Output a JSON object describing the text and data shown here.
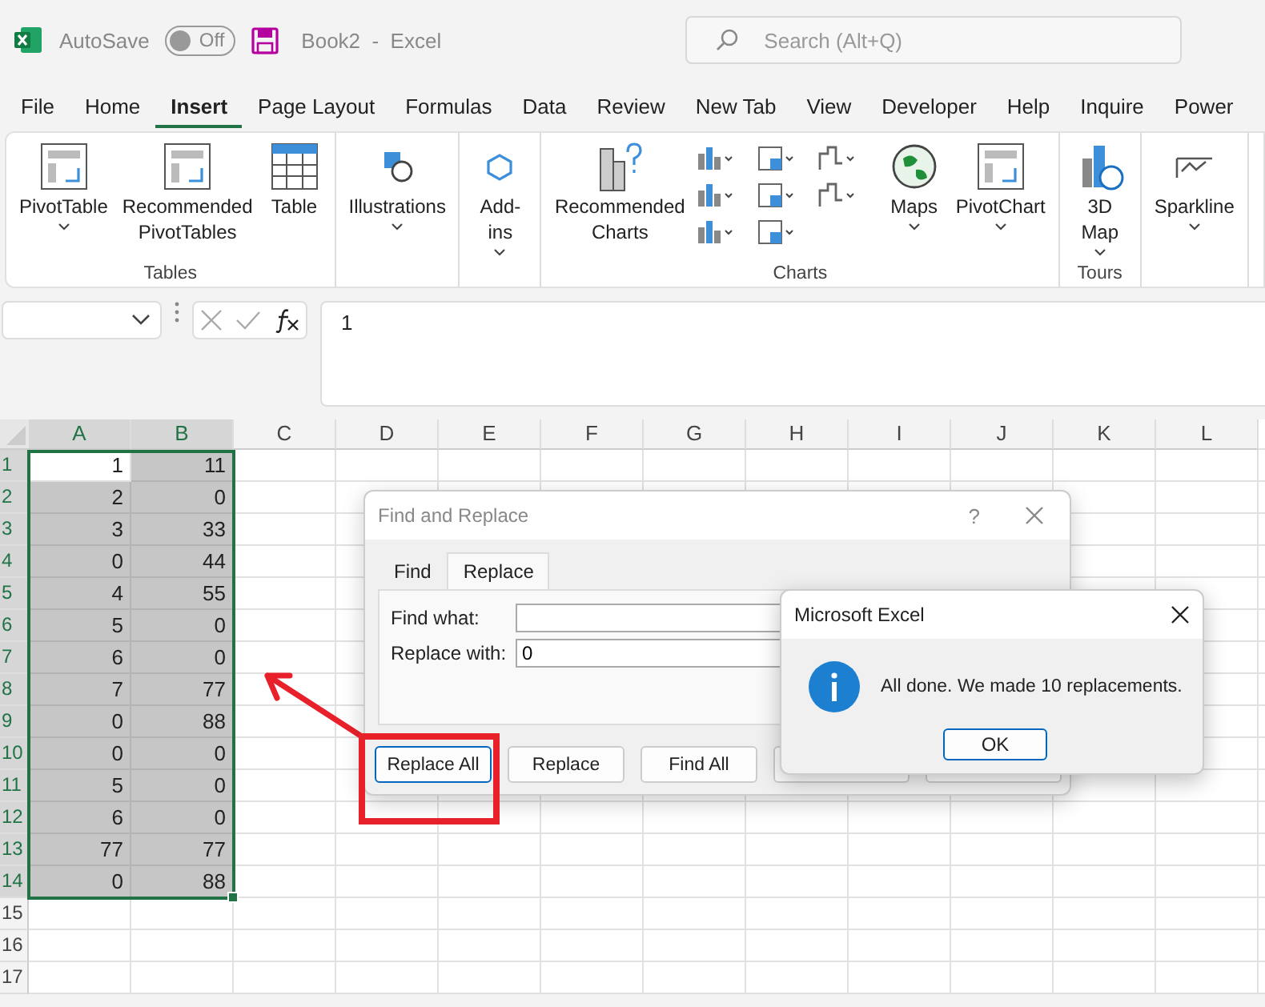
{
  "titlebar": {
    "autosave_label": "AutoSave",
    "autosave_toggle": {
      "label": "Off",
      "on": false
    },
    "document_title": "Book2  -  Excel",
    "search": {
      "placeholder": "Search (Alt+Q)"
    }
  },
  "menu_tabs": [
    {
      "label": "File",
      "selected": false
    },
    {
      "label": "Home",
      "selected": false
    },
    {
      "label": "Insert",
      "selected": true
    },
    {
      "label": "Page Layout",
      "selected": false
    },
    {
      "label": "Formulas",
      "selected": false
    },
    {
      "label": "Data",
      "selected": false
    },
    {
      "label": "Review",
      "selected": false
    },
    {
      "label": "New Tab",
      "selected": false
    },
    {
      "label": "View",
      "selected": false
    },
    {
      "label": "Developer",
      "selected": false
    },
    {
      "label": "Help",
      "selected": false
    },
    {
      "label": "Inquire",
      "selected": false
    },
    {
      "label": "Power",
      "selected": false
    }
  ],
  "ribbon": {
    "groups": [
      {
        "label": "Tables",
        "commands": [
          {
            "label": "PivotTable",
            "dropdown": true
          },
          {
            "label": "Recommended\nPivotTables",
            "dropdown": false
          },
          {
            "label": "Table",
            "dropdown": false
          }
        ]
      },
      {
        "commands": [
          {
            "label": "Illustrations",
            "dropdown": true
          }
        ]
      },
      {
        "commands": [
          {
            "label": "Add-\nins",
            "dropdown": true
          }
        ]
      },
      {
        "label": "Charts",
        "commands": [
          {
            "label": "Recommended\nCharts",
            "dropdown": false
          },
          {
            "kind": "gallery"
          },
          {
            "label": "Maps",
            "dropdown": true
          },
          {
            "label": "PivotChart",
            "dropdown": true
          }
        ]
      },
      {
        "label": "Tours",
        "commands": [
          {
            "label": "3D\nMap",
            "dropdown": true
          }
        ]
      },
      {
        "commands": [
          {
            "label": "Sparkline",
            "dropdown": true
          }
        ]
      }
    ]
  },
  "formula_bar": {
    "formula": "1"
  },
  "sheet": {
    "columns": [
      {
        "label": "A",
        "selected": true
      },
      {
        "label": "B",
        "selected": true
      },
      {
        "label": "C",
        "selected": false
      },
      {
        "label": "D",
        "selected": false
      },
      {
        "label": "E",
        "selected": false
      },
      {
        "label": "F",
        "selected": false
      },
      {
        "label": "G",
        "selected": false
      },
      {
        "label": "H",
        "selected": false
      },
      {
        "label": "I",
        "selected": false
      },
      {
        "label": "J",
        "selected": false
      },
      {
        "label": "K",
        "selected": false
      },
      {
        "label": "L",
        "selected": false
      }
    ],
    "rows": [
      {
        "header": "1",
        "selected": true,
        "cells": [
          {
            "value": "1",
            "shaded": false
          },
          {
            "value": "11",
            "shaded": true
          }
        ]
      },
      {
        "header": "2",
        "selected": true,
        "cells": [
          {
            "value": "2",
            "shaded": true
          },
          {
            "value": "0",
            "shaded": true
          }
        ]
      },
      {
        "header": "3",
        "selected": true,
        "cells": [
          {
            "value": "3",
            "shaded": true
          },
          {
            "value": "33",
            "shaded": true
          }
        ]
      },
      {
        "header": "4",
        "selected": true,
        "cells": [
          {
            "value": "0",
            "shaded": true
          },
          {
            "value": "44",
            "shaded": true
          }
        ]
      },
      {
        "header": "5",
        "selected": true,
        "cells": [
          {
            "value": "4",
            "shaded": true
          },
          {
            "value": "55",
            "shaded": true
          }
        ]
      },
      {
        "header": "6",
        "selected": true,
        "cells": [
          {
            "value": "5",
            "shaded": true
          },
          {
            "value": "0",
            "shaded": true
          }
        ]
      },
      {
        "header": "7",
        "selected": true,
        "cells": [
          {
            "value": "6",
            "shaded": true
          },
          {
            "value": "0",
            "shaded": true
          }
        ]
      },
      {
        "header": "8",
        "selected": true,
        "cells": [
          {
            "value": "7",
            "shaded": true
          },
          {
            "value": "77",
            "shaded": true
          }
        ]
      },
      {
        "header": "9",
        "selected": true,
        "cells": [
          {
            "value": "0",
            "shaded": true
          },
          {
            "value": "88",
            "shaded": true
          }
        ]
      },
      {
        "header": "10",
        "selected": true,
        "cells": [
          {
            "value": "0",
            "shaded": true
          },
          {
            "value": "0",
            "shaded": true
          }
        ]
      },
      {
        "header": "11",
        "selected": true,
        "cells": [
          {
            "value": "5",
            "shaded": true
          },
          {
            "value": "0",
            "shaded": true
          }
        ]
      },
      {
        "header": "12",
        "selected": true,
        "cells": [
          {
            "value": "6",
            "shaded": true
          },
          {
            "value": "0",
            "shaded": true
          }
        ]
      },
      {
        "header": "13",
        "selected": true,
        "cells": [
          {
            "value": "77",
            "shaded": true
          },
          {
            "value": "77",
            "shaded": true
          }
        ]
      },
      {
        "header": "14",
        "selected": true,
        "cells": [
          {
            "value": "0",
            "shaded": true
          },
          {
            "value": "88",
            "shaded": true
          }
        ]
      },
      {
        "header": "15",
        "selected": false,
        "cells": []
      },
      {
        "header": "16",
        "selected": false,
        "cells": []
      },
      {
        "header": "17",
        "selected": false,
        "cells": []
      }
    ]
  },
  "find_replace_dialog": {
    "title": "Find and Replace",
    "help": "?",
    "tabs": [
      {
        "label": "Find",
        "selected": false
      },
      {
        "label": "Replace",
        "selected": true
      }
    ],
    "fields": [
      {
        "label": "Find what:"
      },
      {
        "label": "Replace with:",
        "value": "0"
      }
    ],
    "buttons": [
      {
        "label": "Replace All",
        "default": true
      },
      {
        "label": "Replace",
        "default": false
      },
      {
        "label": "Find All",
        "default": false
      }
    ]
  },
  "message_box": {
    "title": "Microsoft Excel",
    "message": "All done. We made 10 replacements.",
    "button": "OK"
  }
}
